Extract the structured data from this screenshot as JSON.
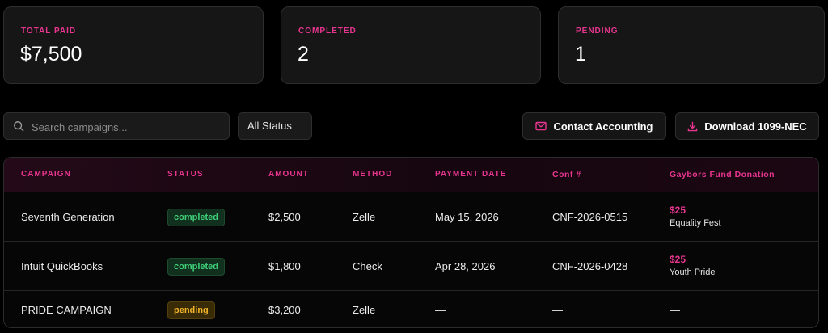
{
  "stats": [
    {
      "label": "TOTAL PAID",
      "value": "$7,500"
    },
    {
      "label": "COMPLETED",
      "value": "2"
    },
    {
      "label": "PENDING",
      "value": "1"
    }
  ],
  "toolbar": {
    "search_placeholder": "Search campaigns...",
    "status_filter": "All Status",
    "contact_label": "Contact Accounting",
    "download_label": "Download 1099-NEC"
  },
  "table": {
    "headers": [
      "CAMPAIGN",
      "STATUS",
      "AMOUNT",
      "METHOD",
      "PAYMENT DATE",
      "Conf #",
      "Gaybors Fund Donation"
    ],
    "rows": [
      {
        "campaign": "Seventh Generation",
        "status": "completed",
        "amount": "$2,500",
        "method": "Zelle",
        "date": "May 15, 2026",
        "conf": "CNF-2026-0515",
        "donation_amount": "$25",
        "donation_event": "Equality Fest"
      },
      {
        "campaign": "Intuit QuickBooks",
        "status": "completed",
        "amount": "$1,800",
        "method": "Check",
        "date": "Apr 28, 2026",
        "conf": "CNF-2026-0428",
        "donation_amount": "$25",
        "donation_event": "Youth Pride"
      },
      {
        "campaign": "PRIDE CAMPAIGN",
        "status": "pending",
        "amount": "$3,200",
        "method": "Zelle",
        "date": "—",
        "conf": "—",
        "donation_amount": "—"
      }
    ]
  },
  "icons": {
    "search": "search-icon",
    "mail": "mail-icon",
    "download": "download-icon"
  },
  "colors": {
    "accent": "#e8358f",
    "completed": "#3fd17a",
    "pending": "#f0b429"
  }
}
